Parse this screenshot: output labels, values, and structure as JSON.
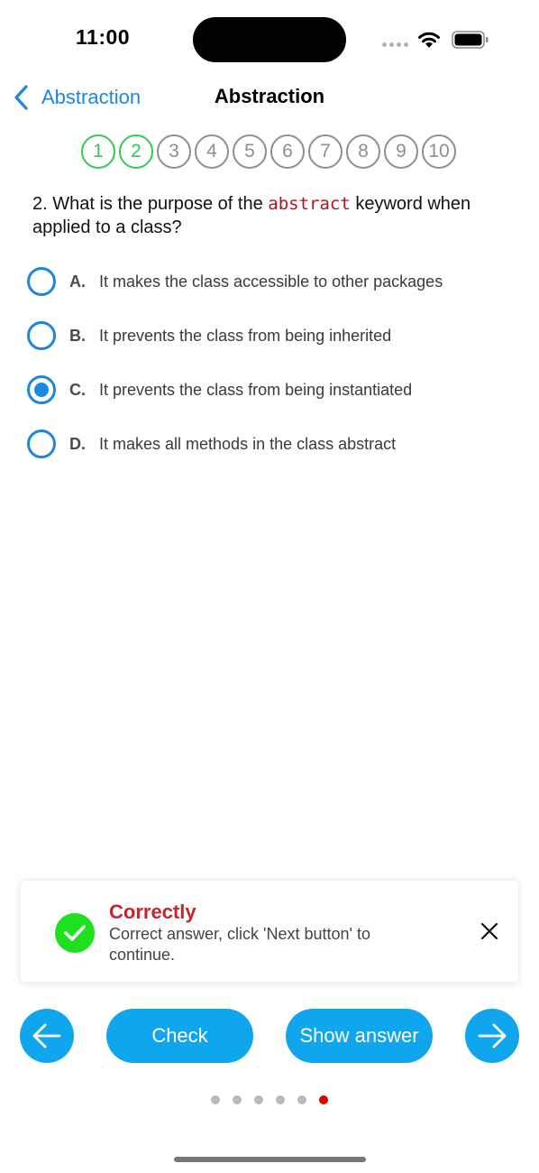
{
  "status_bar": {
    "time": "11:00"
  },
  "nav": {
    "back_label": "Abstraction",
    "title": "Abstraction"
  },
  "stepper": {
    "steps": [
      {
        "label": "1",
        "state": "done"
      },
      {
        "label": "2",
        "state": "done"
      },
      {
        "label": "3",
        "state": "pending"
      },
      {
        "label": "4",
        "state": "pending"
      },
      {
        "label": "5",
        "state": "pending"
      },
      {
        "label": "6",
        "state": "pending"
      },
      {
        "label": "7",
        "state": "pending"
      },
      {
        "label": "8",
        "state": "pending"
      },
      {
        "label": "9",
        "state": "pending"
      },
      {
        "label": "10",
        "state": "pending"
      }
    ]
  },
  "question": {
    "prefix": "2. What is the purpose of the ",
    "code": "abstract",
    "suffix": " keyword when applied to a class?"
  },
  "options": [
    {
      "letter": "A.",
      "text": "It makes the class accessible to other packages",
      "selected": false
    },
    {
      "letter": "B.",
      "text": "It prevents the class from being inherited",
      "selected": false
    },
    {
      "letter": "C.",
      "text": "It prevents the class from being instantiated",
      "selected": true
    },
    {
      "letter": "D.",
      "text": "It makes all methods in the class abstract",
      "selected": false
    }
  ],
  "toast": {
    "title": "Correctly",
    "message": "Correct answer, click 'Next button' to continue."
  },
  "controls": {
    "check_label": "Check",
    "show_answer_label": "Show answer"
  },
  "pager": {
    "total": 6,
    "active_index": 5
  },
  "colors": {
    "accent": "#1f86e0",
    "button": "#10a6ee",
    "done": "#34c759",
    "success_icon": "#1fe01f",
    "toast_title": "#c1272d",
    "code": "#b5121b",
    "active_dot": "#e00000"
  }
}
